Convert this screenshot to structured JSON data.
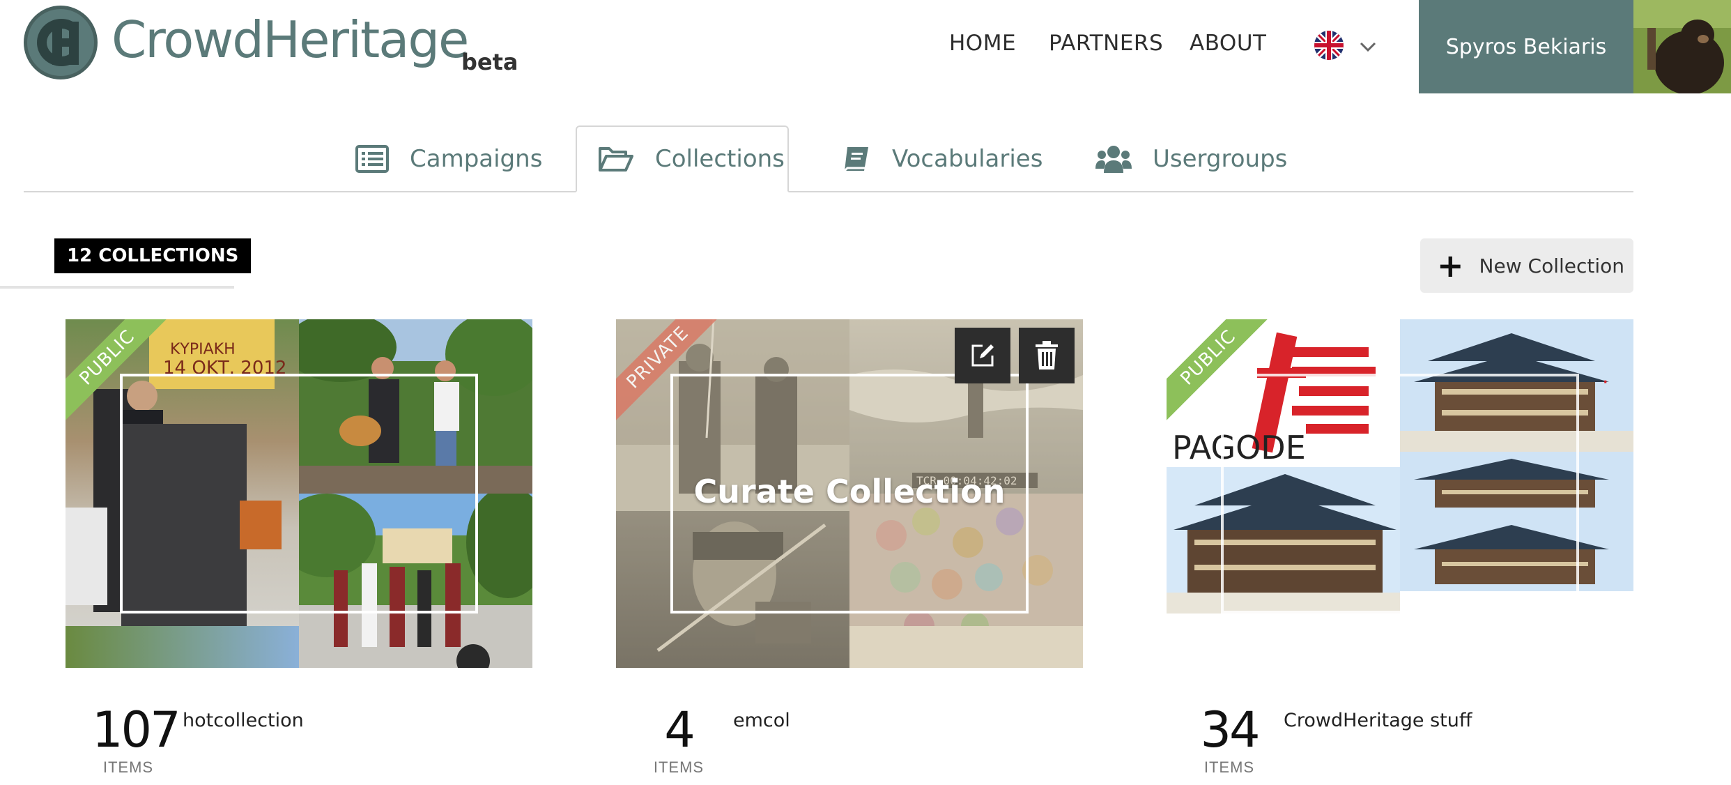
{
  "header": {
    "brand": "CrowdHeritage",
    "beta": "beta",
    "nav": [
      "HOME",
      "PARTNERS",
      "ABOUT"
    ],
    "language_icon": "uk-flag-icon",
    "user_name": "Spyros Bekiaris"
  },
  "tabs": [
    {
      "label": "Campaigns",
      "icon": "list-icon"
    },
    {
      "label": "Collections",
      "icon": "folder-open-icon"
    },
    {
      "label": "Vocabularies",
      "icon": "book-icon"
    },
    {
      "label": "Usergroups",
      "icon": "users-icon"
    }
  ],
  "toolbar": {
    "count_label": "12 COLLECTIONS",
    "new_collection": "New Collection"
  },
  "collections": [
    {
      "count": "107",
      "items_label": "ITEMS",
      "name": "hotcollection",
      "visibility": "PUBLIC"
    },
    {
      "count": "4",
      "items_label": "ITEMS",
      "name": "emcol",
      "visibility": "PRIVATE",
      "hover_label": "Curate Collection"
    },
    {
      "count": "34",
      "items_label": "ITEMS",
      "name": "CrowdHeritage stuff",
      "visibility": "PUBLIC",
      "thumb_text": "PAGODE"
    }
  ],
  "colors": {
    "brand": "#5b7a79",
    "public_ribbon": "#8dc05a",
    "private_ribbon": "#d97a66"
  }
}
